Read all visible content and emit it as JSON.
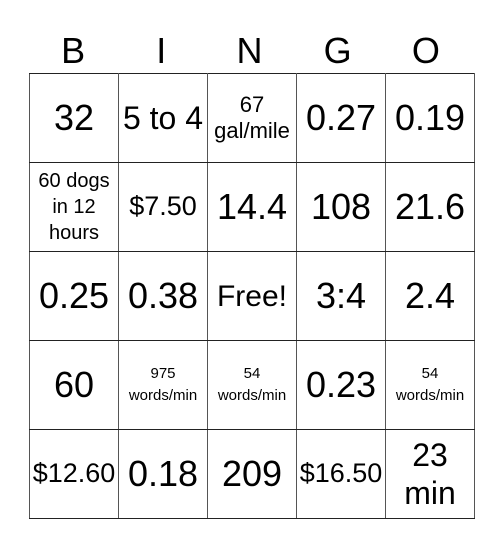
{
  "header": [
    "B",
    "I",
    "N",
    "G",
    "O"
  ],
  "rows": [
    [
      {
        "text": "32",
        "size": "xl"
      },
      {
        "text": "5 to 4",
        "size": "l"
      },
      {
        "text": "67 gal/mile",
        "size": "sm"
      },
      {
        "text": "0.27",
        "size": "xl"
      },
      {
        "text": "0.19",
        "size": "xl"
      }
    ],
    [
      {
        "text": "60 dogs in 12 hours",
        "size": "s"
      },
      {
        "text": "$7.50",
        "size": "m"
      },
      {
        "text": "14.4",
        "size": "xl"
      },
      {
        "text": "108",
        "size": "xl"
      },
      {
        "text": "21.6",
        "size": "xl"
      }
    ],
    [
      {
        "text": "0.25",
        "size": "xl"
      },
      {
        "text": "0.38",
        "size": "xl"
      },
      {
        "text": "Free!",
        "size": "free"
      },
      {
        "text": "3:4",
        "size": "xl"
      },
      {
        "text": "2.4",
        "size": "xl"
      }
    ],
    [
      {
        "text": "60",
        "size": "xl"
      },
      {
        "text": "975 words/min",
        "size": "xs"
      },
      {
        "text": "54 words/min",
        "size": "xs"
      },
      {
        "text": "0.23",
        "size": "xl"
      },
      {
        "text": "54 words/min",
        "size": "xs"
      }
    ],
    [
      {
        "text": "$12.60",
        "size": "m"
      },
      {
        "text": "0.18",
        "size": "xl"
      },
      {
        "text": "209",
        "size": "xl"
      },
      {
        "text": "$16.50",
        "size": "m"
      },
      {
        "text": "23 min",
        "size": "l"
      }
    ]
  ]
}
